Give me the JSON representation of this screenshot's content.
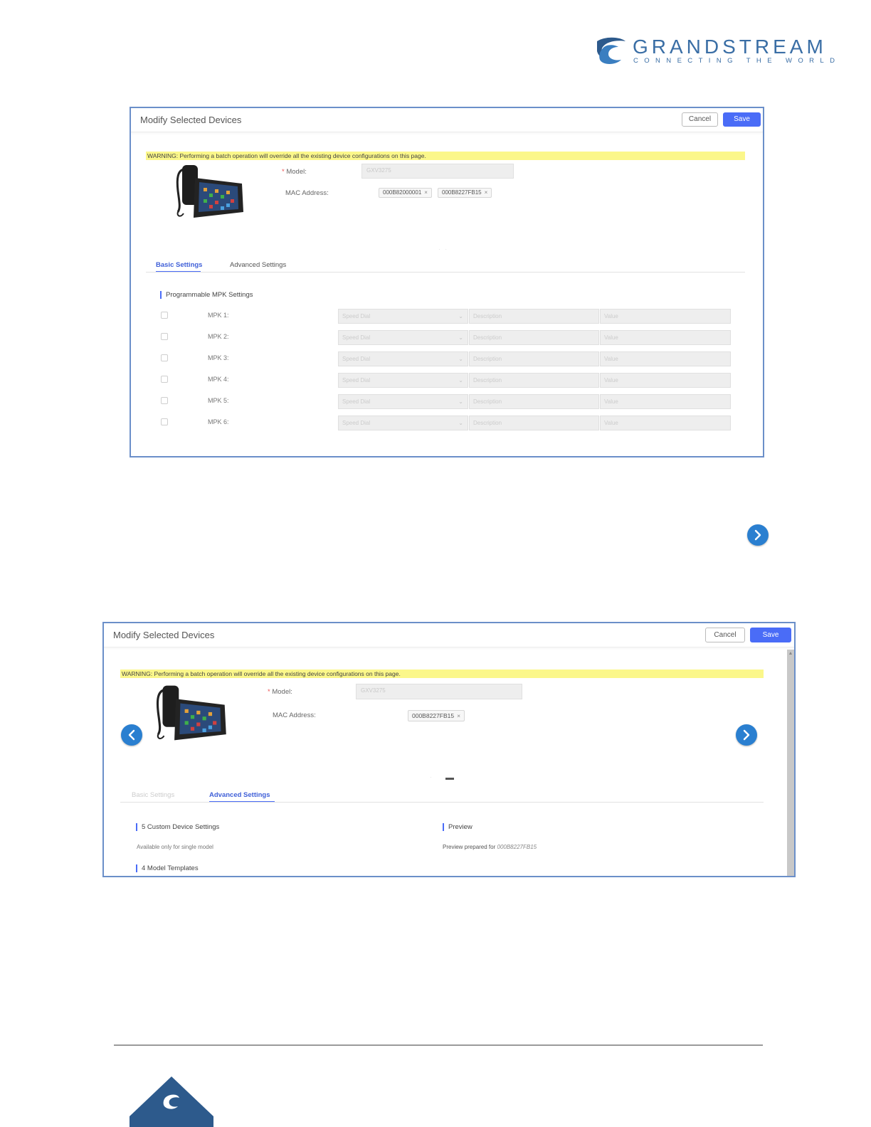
{
  "brand": {
    "word": "GRANDSTREAM",
    "tagline": "CONNECTING THE WORLD",
    "color": "#3a6ea5"
  },
  "panel1": {
    "title": "Modify Selected Devices",
    "cancel_label": "Cancel",
    "save_label": "Save",
    "warning": "WARNING: Performing a batch operation will override all the existing device configurations on this page.",
    "model_label": "Model:",
    "model_value": "GXV3275",
    "mac_label": "MAC Address:",
    "mac_tags": [
      "000B82000001",
      "000B8227FB15"
    ],
    "tabs": [
      "Basic Settings",
      "Advanced Settings"
    ],
    "active_tab": "Basic Settings",
    "section_title": "Programmable MPK Settings",
    "mpk_rows": [
      {
        "label": "MPK 1:",
        "mode": "Speed Dial",
        "description": "Description",
        "value": "Value"
      },
      {
        "label": "MPK 2:",
        "mode": "Speed Dial",
        "description": "Description",
        "value": "Value"
      },
      {
        "label": "MPK 3:",
        "mode": "Speed Dial",
        "description": "Description",
        "value": "Value"
      },
      {
        "label": "MPK 4:",
        "mode": "Speed Dial",
        "description": "Description",
        "value": "Value"
      },
      {
        "label": "MPK 5:",
        "mode": "Speed Dial",
        "description": "Description",
        "value": "Value"
      },
      {
        "label": "MPK 6:",
        "mode": "Speed Dial",
        "description": "Description",
        "value": "Value"
      }
    ]
  },
  "panel2": {
    "title": "Modify Selected Devices",
    "cancel_label": "Cancel",
    "save_label": "Save",
    "warning": "WARNING: Performing a batch operation will override all the existing device configurations on this page.",
    "model_label": "Model:",
    "model_value": "GXV3275",
    "mac_label": "MAC Address:",
    "mac_tags": [
      "000B8227FB15"
    ],
    "tabs": [
      "Basic Settings",
      "Advanced Settings"
    ],
    "active_tab": "Advanced Settings",
    "custom_settings_title": "5 Custom Device Settings",
    "custom_settings_note": "Available only for single model",
    "templates_title": "4 Model Templates",
    "preview_title": "Preview",
    "preview_prefix": "Preview prepared for",
    "preview_mac": "000B8227FB15"
  },
  "colors": {
    "accent": "#4a6cf7",
    "warning_bg": "#fbf78a",
    "panel_border": "#6b8fc9",
    "nav_button": "#2a7fd0"
  }
}
